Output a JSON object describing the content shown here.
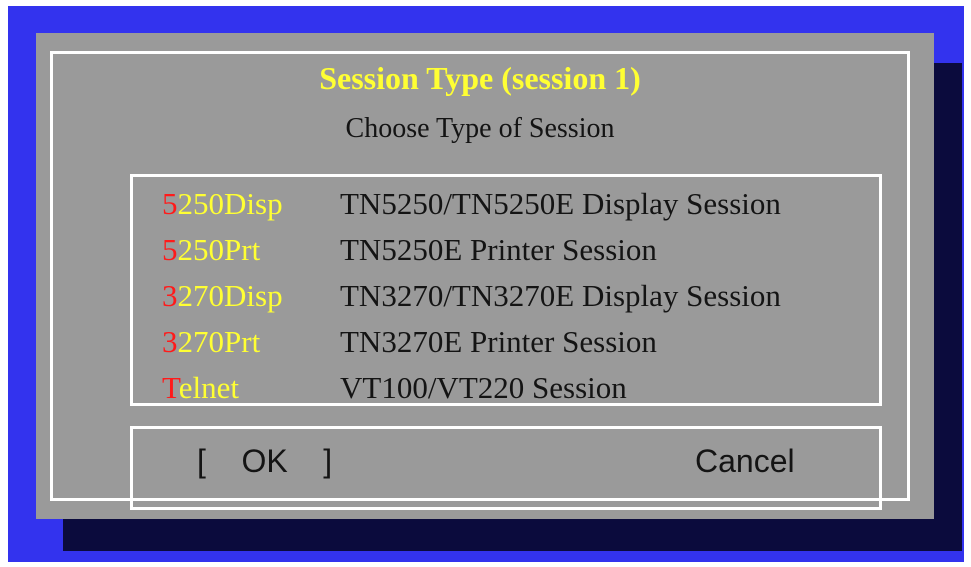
{
  "dialog": {
    "title": "Session Type (session 1)",
    "subtitle": "Choose Type of Session"
  },
  "sessions": [
    {
      "hotkey": "5",
      "code_rest": "250Disp",
      "description": "TN5250/TN5250E Display Session"
    },
    {
      "hotkey": "5",
      "code_rest": "250Prt",
      "description": "TN5250E Printer Session"
    },
    {
      "hotkey": "3",
      "code_rest": "270Disp",
      "description": "TN3270/TN3270E Display Session"
    },
    {
      "hotkey": "3",
      "code_rest": "270Prt",
      "description": "TN3270E Printer Session"
    },
    {
      "hotkey": "T",
      "code_rest": "elnet",
      "description": "VT100/VT220 Session"
    }
  ],
  "buttons": {
    "ok_label": "[    OK    ]",
    "cancel_label": "Cancel"
  },
  "colors": {
    "screen_background": "#3333ee",
    "dialog_background": "#9a9a9a",
    "title_color": "#ffff33",
    "hotkey_color": "#ff1a1a",
    "code_color": "#ffff33",
    "frame_color": "#ffffff"
  }
}
